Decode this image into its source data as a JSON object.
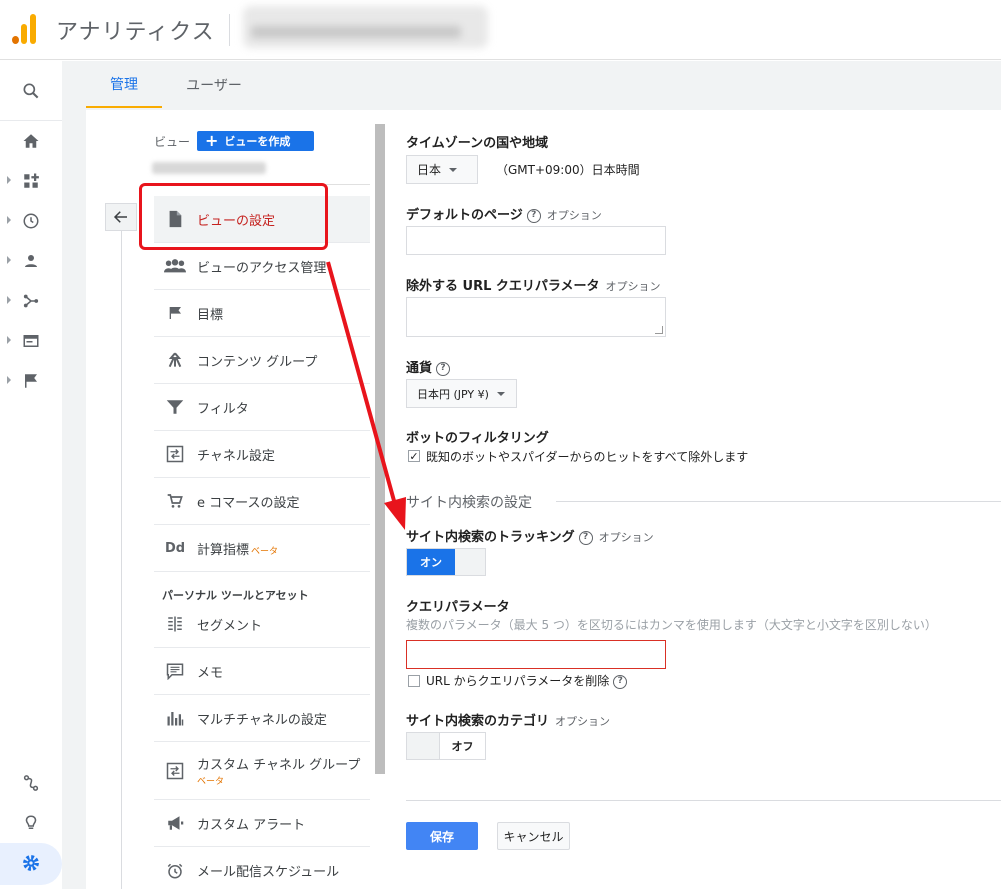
{
  "header": {
    "app_title": "アナリティクス"
  },
  "tabs": [
    {
      "label": "管理"
    },
    {
      "label": "ユーザー"
    }
  ],
  "view_column": {
    "view_label": "ビュー",
    "create_view_label": "ビューを作成",
    "items": [
      {
        "label": "ビューの設定",
        "icon": "document-icon"
      },
      {
        "label": "ビューのアクセス管理",
        "icon": "people-icon"
      },
      {
        "label": "目標",
        "icon": "flag-icon"
      },
      {
        "label": "コンテンツ グループ",
        "icon": "content-group-icon"
      },
      {
        "label": "フィルタ",
        "icon": "filter-icon"
      },
      {
        "label": "チャネル設定",
        "icon": "channel-icon"
      },
      {
        "label": "e コマースの設定",
        "icon": "cart-icon"
      },
      {
        "label": "計算指標",
        "icon": "dd-icon",
        "beta": "ベータ"
      }
    ],
    "section_header": "パーソナル ツールとアセット",
    "personal_items": [
      {
        "label": "セグメント",
        "icon": "segment-icon"
      },
      {
        "label": "メモ",
        "icon": "memo-icon"
      },
      {
        "label": "マルチチャネルの設定",
        "icon": "bar-chart-icon"
      },
      {
        "label": "カスタム チャネル グループ",
        "icon": "channel-icon",
        "beta": "ベータ"
      },
      {
        "label": "カスタム アラート",
        "icon": "megaphone-icon"
      },
      {
        "label": "メール配信スケジュール",
        "icon": "clock-icon"
      }
    ]
  },
  "form": {
    "timezone": {
      "label": "タイムゾーンの国や地域",
      "country": "日本",
      "tz_text": "（GMT+09:00）日本時間"
    },
    "default_page": {
      "label": "デフォルトのページ",
      "optional": "オプション",
      "value": ""
    },
    "exclude_params": {
      "label": "除外する URL クエリパラメータ",
      "optional": "オプション",
      "value": ""
    },
    "currency": {
      "label": "通貨",
      "value": "日本円 (JPY ¥)"
    },
    "bot_filtering": {
      "label": "ボットのフィルタリング",
      "checkbox_label": "既知のボットやスパイダーからのヒットをすべて除外します",
      "checked": true
    },
    "site_search_section": "サイト内検索の設定",
    "site_search_tracking": {
      "label": "サイト内検索のトラッキング",
      "optional": "オプション",
      "toggle": "オン"
    },
    "query_param": {
      "label": "クエリパラメータ",
      "hint": "複数のパラメータ（最大 5 つ）を区切るにはカンマを使用します（大文字と小文字を区別しない）",
      "value": ""
    },
    "remove_query": {
      "label": "URL からクエリパラメータを削除",
      "checked": false
    },
    "site_search_category": {
      "label": "サイト内検索のカテゴリ",
      "optional": "オプション",
      "toggle": "オフ"
    },
    "save_label": "保存",
    "cancel_label": "キャンセル"
  },
  "colors": {
    "accent": "#1a73e8",
    "annotation_red": "#e8141c",
    "logo_orange": "#f9ab00"
  }
}
